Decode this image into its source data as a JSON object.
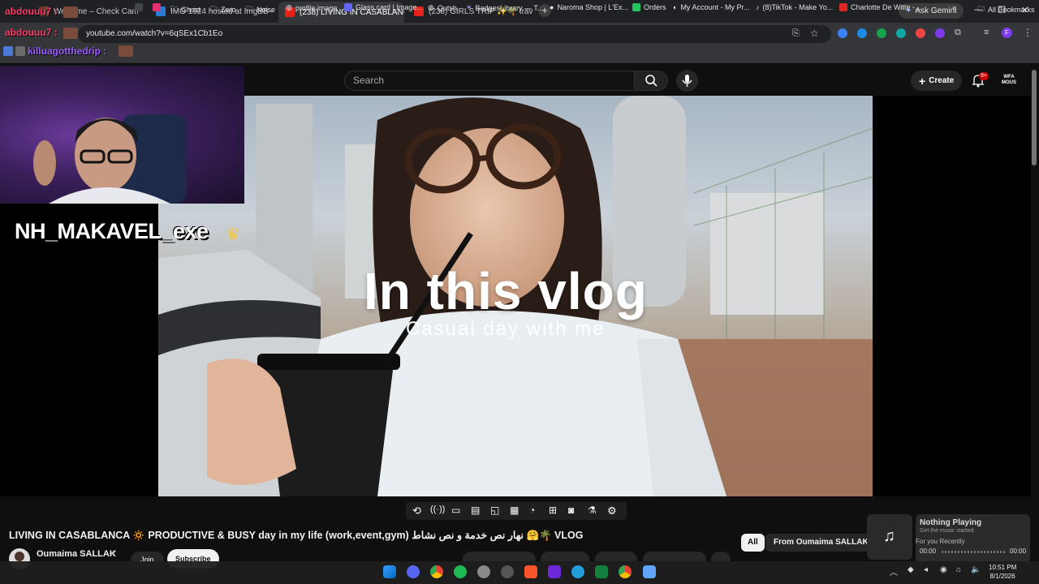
{
  "browser": {
    "tabs": [
      {
        "label": "Welcome – Check Cam",
        "color": "#6b3b2a"
      },
      {
        "label": "IMG 1924 hosted at ImgBB — I",
        "color": "#2a7bd3"
      },
      {
        "label": "(238) LIVING IN CASABLANCA",
        "color": "#e62117"
      },
      {
        "label": "(238) GIRLS TRIP ✨🌴 travel v",
        "color": "#e62117"
      }
    ],
    "new_tab": "+",
    "ask_gemini": "Ask Gemini",
    "url": "youtube.com/watch?v=6qSEx1Cb1Eo",
    "bookmarks": [
      {
        "label": "Ghost"
      },
      {
        "label": "Zero"
      },
      {
        "label": "Noise"
      },
      {
        "label": "profile image"
      },
      {
        "label": "Glass card | Image..."
      },
      {
        "label": "Qutsh"
      },
      {
        "label": "BadgesLibrary — T..."
      },
      {
        "label": "Naroma Shop | L'Ex..."
      },
      {
        "label": "Orders"
      },
      {
        "label": "My Account - My Pr..."
      },
      {
        "label": "(8)TikTok - Make Yo..."
      },
      {
        "label": "Charlotte De Witte -..."
      }
    ],
    "all_bookmarks": "All Bookmarks"
  },
  "chat_overlay": {
    "names": [
      "abdouuu7 :",
      "abdouuu7 :",
      "killuagotthedrip :"
    ],
    "colors": [
      "#ff3b6b",
      "#ff3b6b",
      "#9b5cff"
    ]
  },
  "stream": {
    "streamer_name": "NH_MAKAVEL_exe"
  },
  "youtube": {
    "search_placeholder": "Search",
    "create_label": "Create",
    "notif_badge": "9+",
    "video_overlay_title": "In this vlog",
    "video_overlay_subtitle": "Casual day with me",
    "video_title": "LIVING IN CASABLANCA 🔅 PRODUCTIVE & BUSY day in my life (work,event,gym) نهار نص خدمة و نص نشاط 🤗🌴 VLOG",
    "channel_name": "Oumaima SALLAK",
    "join_label": "Join",
    "subscribe_label": "Subscribe",
    "chips": {
      "all": "All",
      "from": "From Oumaima SALLAK"
    }
  },
  "music_widget": {
    "title": "Nothing Playing",
    "subtitle": "Get the music started",
    "time_start": "00:00",
    "time_end": "00:00",
    "overlap_text": "For you     Recently"
  },
  "taskbar": {
    "time": "10:51 PM",
    "date": "8/1/2026"
  }
}
